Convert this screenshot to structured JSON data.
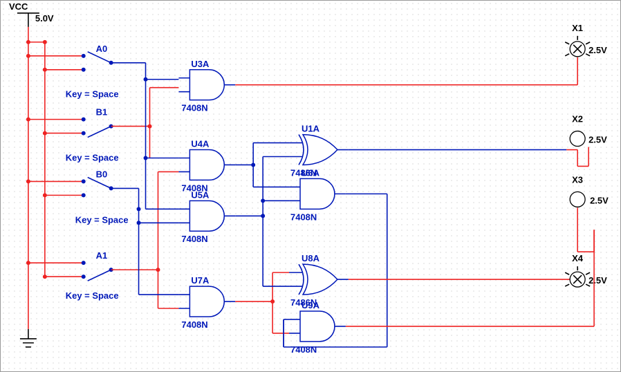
{
  "power": {
    "vcc_label": "VCC",
    "vcc_value": "5.0V"
  },
  "switches": [
    {
      "name": "A0",
      "key_label": "Key = Space"
    },
    {
      "name": "B1",
      "key_label": "Key = Space"
    },
    {
      "name": "B0",
      "key_label": "Key = Space"
    },
    {
      "name": "A1",
      "key_label": "Key = Space"
    }
  ],
  "gates": [
    {
      "ref": "U3A",
      "part": "7408N",
      "type": "AND"
    },
    {
      "ref": "U4A",
      "part": "7408N",
      "type": "AND"
    },
    {
      "ref": "U5A",
      "part": "7408N",
      "type": "AND"
    },
    {
      "ref": "U7A",
      "part": "7408N",
      "type": "AND"
    },
    {
      "ref": "U1A",
      "part": "7486N",
      "type": "XOR"
    },
    {
      "ref": "U6A",
      "part": "7408N",
      "type": "AND"
    },
    {
      "ref": "U8A",
      "part": "7486N",
      "type": "XOR"
    },
    {
      "ref": "U9A",
      "part": "7408N",
      "type": "AND"
    }
  ],
  "outputs": [
    {
      "name": "X1",
      "voltage": "2.5V",
      "lit": true
    },
    {
      "name": "X2",
      "voltage": "2.5V",
      "lit": false
    },
    {
      "name": "X3",
      "voltage": "2.5V",
      "lit": false
    },
    {
      "name": "X4",
      "voltage": "2.5V",
      "lit": true
    }
  ]
}
